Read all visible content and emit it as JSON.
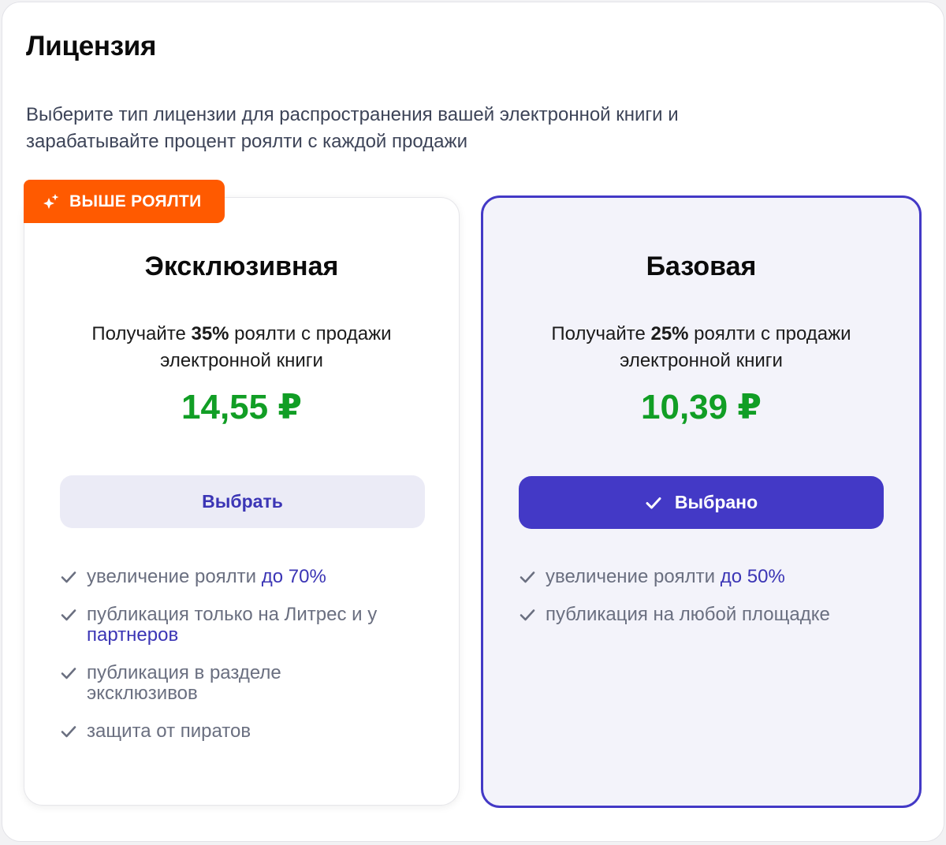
{
  "page": {
    "title": "Лицензия",
    "description": "Выберите тип лицензии для распространения вашей электронной книги и зарабатывайте процент роялти с каждой продажи"
  },
  "exclusive": {
    "badge": "ВЫШЕ РОЯЛТИ",
    "title": "Эксклюзивная",
    "desc_prefix": "Получайте ",
    "percent": "35%",
    "desc_suffix": " роялти с продажи электронной книги",
    "price": "14,55 ₽",
    "button_label": "Выбрать",
    "features": [
      {
        "text": "увеличение роялти ",
        "accent": "до 70%"
      },
      {
        "text": "публикация только на Литрес и у ",
        "accent": "партнеров"
      },
      {
        "text": "публикация в разделе эксклюзивов",
        "accent": ""
      },
      {
        "text": "защита от пиратов",
        "accent": ""
      }
    ]
  },
  "basic": {
    "title": "Базовая",
    "desc_prefix": "Получайте ",
    "percent": "25%",
    "desc_suffix": " роялти с продажи электронной книги",
    "price": "10,39 ₽",
    "button_label": "Выбрано",
    "selected": true,
    "features": [
      {
        "text": "увеличение роялти ",
        "accent": "до 50%"
      },
      {
        "text": "публикация на любой площадке",
        "accent": ""
      }
    ]
  },
  "colors": {
    "accent": "#4339c6",
    "badge": "#ff5a00",
    "price": "#119e25",
    "muted_text": "#6a6f80"
  },
  "icons": {
    "badge": "sparkle-icon",
    "feature": "check-icon",
    "selected_button": "check-icon"
  }
}
